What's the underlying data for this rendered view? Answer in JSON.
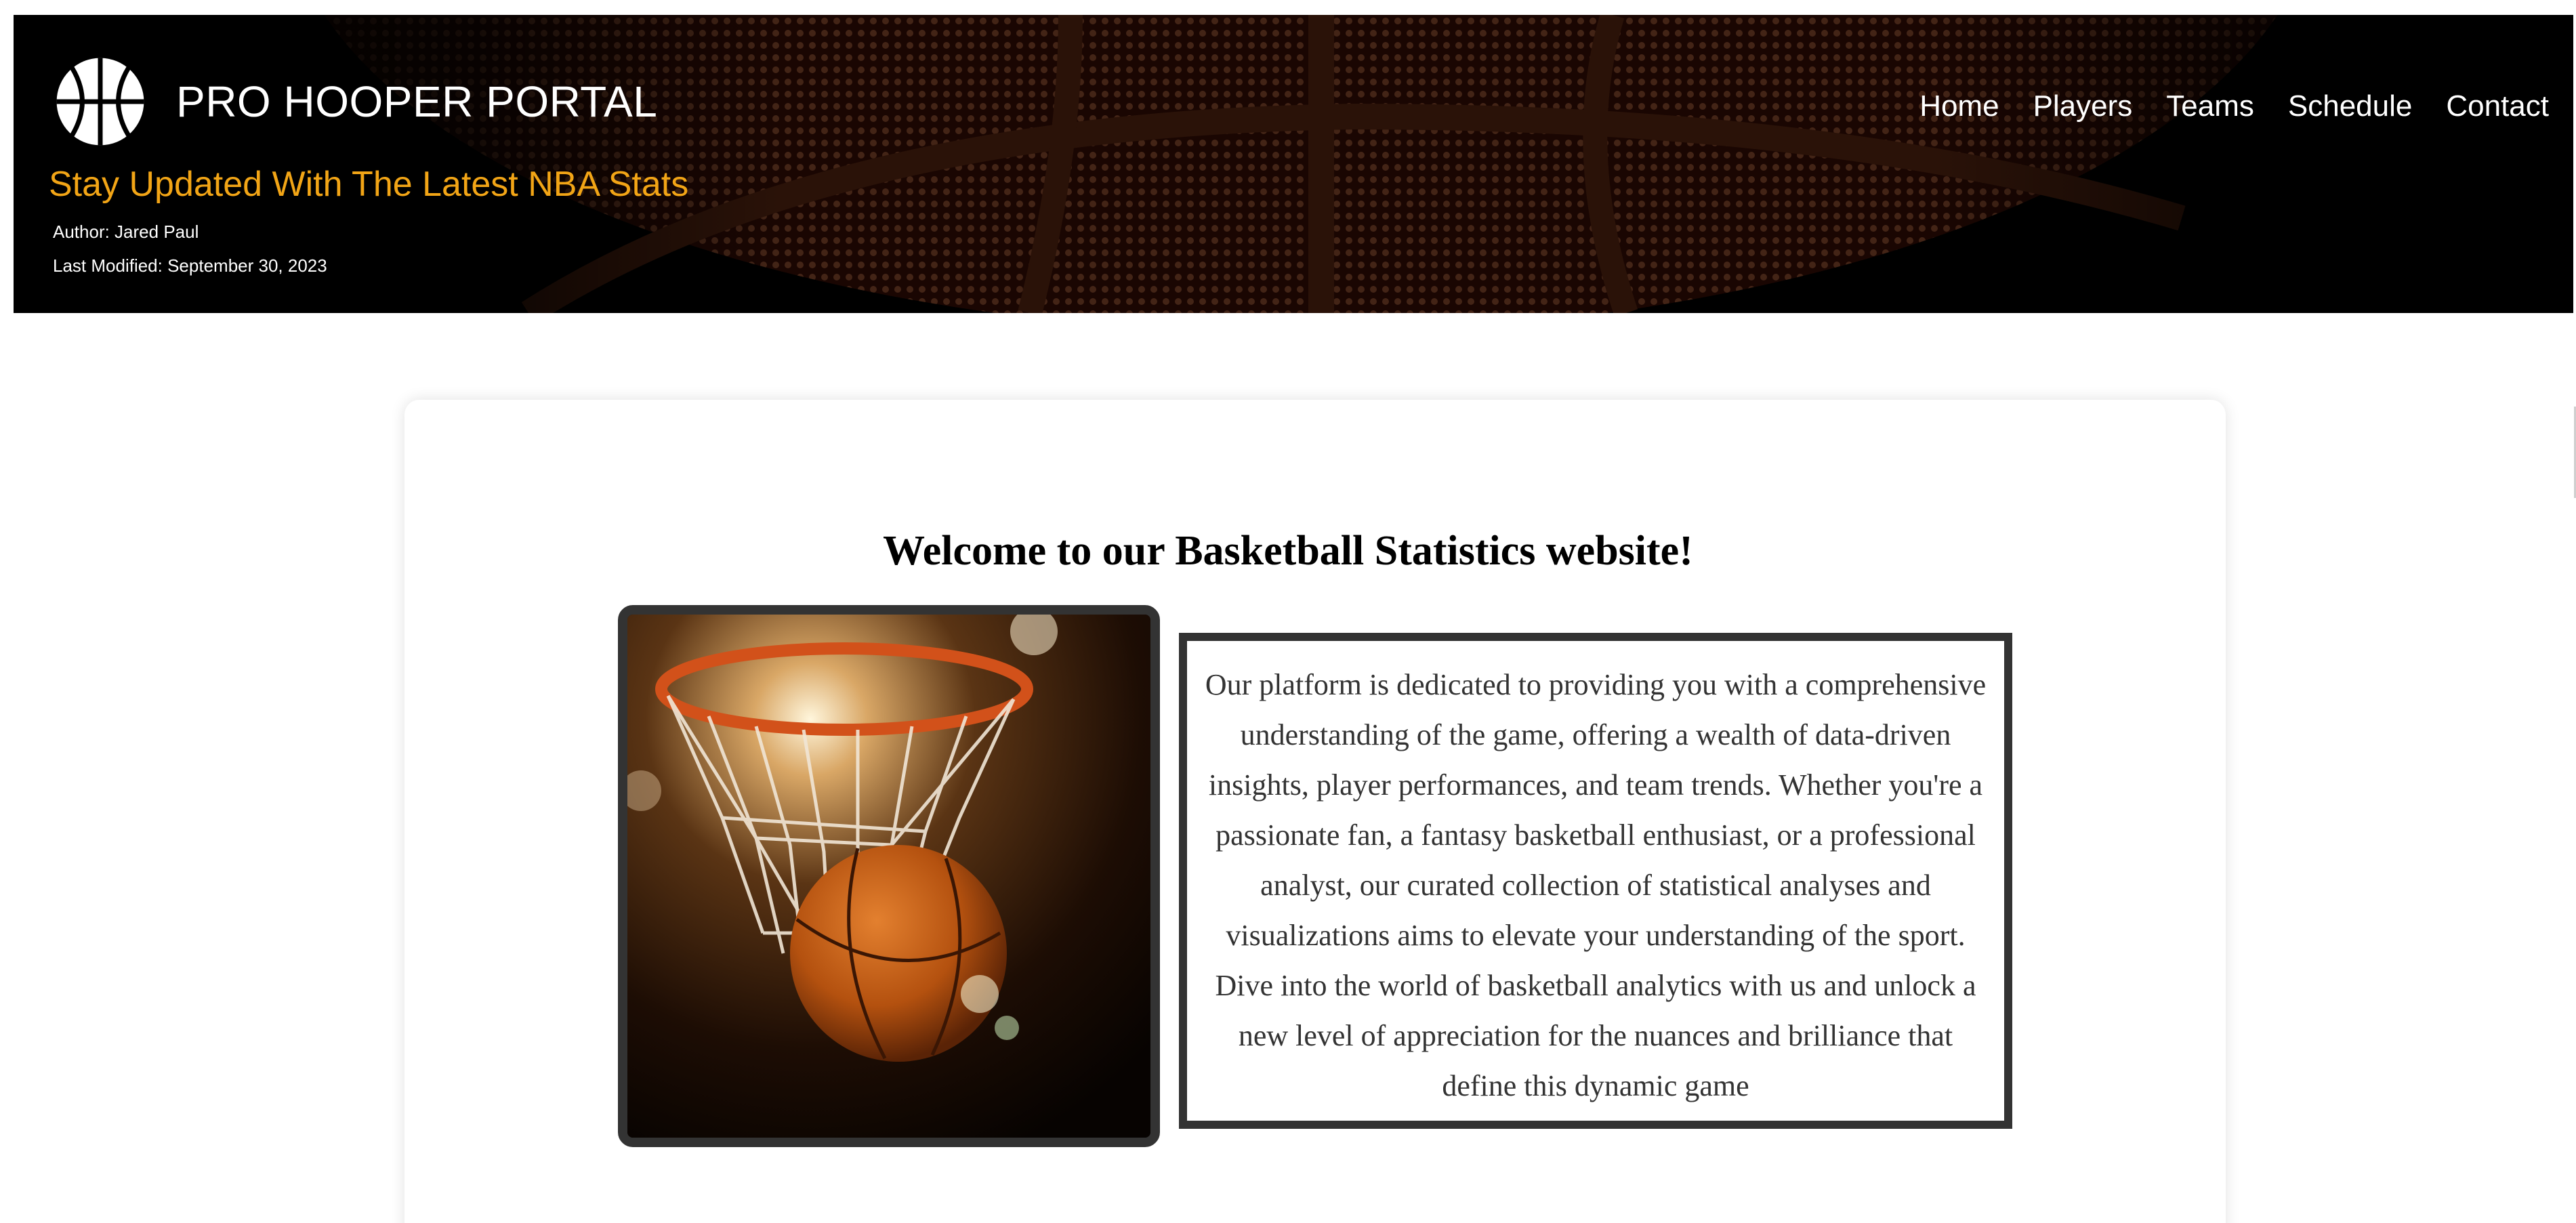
{
  "header": {
    "site_title": "PRO HOOPER PORTAL",
    "tagline": "Stay Updated With The Latest NBA Stats",
    "author": "Author: Jared Paul",
    "last_modified": "Last Modified: September 30, 2023",
    "logo_icon": "basketball-icon",
    "banner_image": "basketball-closeup-image"
  },
  "nav": {
    "items": [
      {
        "label": "Home"
      },
      {
        "label": "Players"
      },
      {
        "label": "Teams"
      },
      {
        "label": "Schedule"
      },
      {
        "label": "Contact"
      }
    ]
  },
  "main": {
    "heading": "Welcome to our Basketball Statistics website!",
    "image": "basketball-hoop-net-image",
    "intro_text": "Our platform is dedicated to providing you with a comprehensive understanding of the game, offering a wealth of data-driven insights, player performances, and team trends. Whether you're a passionate fan, a fantasy basketball enthusiast, or a professional analyst, our curated collection of statistical analyses and visualizations aims to elevate your understanding of the sport. Dive into the world of basketball analytics with us and unlock a new level of appreciation for the nuances and brilliance that define this dynamic game"
  },
  "colors": {
    "header_bg": "#000000",
    "tagline": "#f2a516",
    "ball_orange": "#c24a15",
    "frame_border": "#333333",
    "body_text": "#333333"
  }
}
